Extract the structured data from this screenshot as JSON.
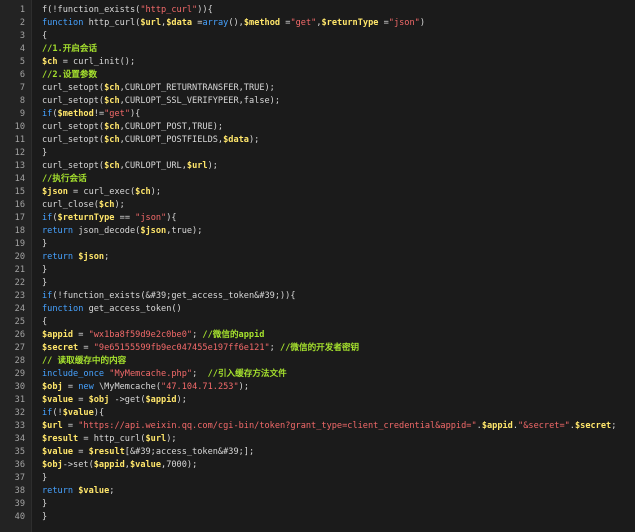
{
  "editor": {
    "line_numbers": [
      "1",
      "2",
      "3",
      "4",
      "5",
      "6",
      "7",
      "8",
      "9",
      "10",
      "11",
      "12",
      "13",
      "14",
      "15",
      "16",
      "17",
      "18",
      "19",
      "20",
      "21",
      "22",
      "23",
      "24",
      "25",
      "26",
      "27",
      "28",
      "29",
      "30",
      "31",
      "32",
      "33",
      "34",
      "35",
      "36",
      "37",
      "38",
      "39",
      "40"
    ],
    "lines": [
      [
        {
          "t": "f(!function_exists(",
          "c": "default"
        },
        {
          "t": "\"http_curl\"",
          "c": "str"
        },
        {
          "t": ")){",
          "c": "default"
        }
      ],
      [
        {
          "t": "function",
          "c": "kw"
        },
        {
          "t": " http_curl(",
          "c": "default"
        },
        {
          "t": "$url",
          "c": "var"
        },
        {
          "t": ",",
          "c": "default"
        },
        {
          "t": "$data",
          "c": "var"
        },
        {
          "t": " =",
          "c": "default"
        },
        {
          "t": "array",
          "c": "kw"
        },
        {
          "t": "(),",
          "c": "default"
        },
        {
          "t": "$method",
          "c": "var"
        },
        {
          "t": " =",
          "c": "default"
        },
        {
          "t": "\"get\"",
          "c": "str"
        },
        {
          "t": ",",
          "c": "default"
        },
        {
          "t": "$returnType",
          "c": "var"
        },
        {
          "t": " =",
          "c": "default"
        },
        {
          "t": "\"json\"",
          "c": "str"
        },
        {
          "t": ")",
          "c": "default"
        }
      ],
      [
        {
          "t": "{",
          "c": "default"
        }
      ],
      [
        {
          "t": "//1.开启会话",
          "c": "com"
        }
      ],
      [
        {
          "t": "$ch",
          "c": "var"
        },
        {
          "t": " = curl_init();",
          "c": "default"
        }
      ],
      [
        {
          "t": "//2.设置参数",
          "c": "com"
        }
      ],
      [
        {
          "t": "curl_setopt(",
          "c": "default"
        },
        {
          "t": "$ch",
          "c": "var"
        },
        {
          "t": ",CURLOPT_RETURNTRANSFER,TRUE);",
          "c": "default"
        }
      ],
      [
        {
          "t": "curl_setopt(",
          "c": "default"
        },
        {
          "t": "$ch",
          "c": "var"
        },
        {
          "t": ",CURLOPT_SSL_VERIFYPEER,false);",
          "c": "default"
        }
      ],
      [
        {
          "t": "if",
          "c": "kw"
        },
        {
          "t": "(",
          "c": "default"
        },
        {
          "t": "$method",
          "c": "var"
        },
        {
          "t": "!=",
          "c": "default"
        },
        {
          "t": "\"get\"",
          "c": "str"
        },
        {
          "t": "){",
          "c": "default"
        }
      ],
      [
        {
          "t": "curl_setopt(",
          "c": "default"
        },
        {
          "t": "$ch",
          "c": "var"
        },
        {
          "t": ",CURLOPT_POST,TRUE);",
          "c": "default"
        }
      ],
      [
        {
          "t": "curl_setopt(",
          "c": "default"
        },
        {
          "t": "$ch",
          "c": "var"
        },
        {
          "t": ",CURLOPT_POSTFIELDS,",
          "c": "default"
        },
        {
          "t": "$data",
          "c": "var"
        },
        {
          "t": ");",
          "c": "default"
        }
      ],
      [
        {
          "t": "}",
          "c": "default"
        }
      ],
      [
        {
          "t": "curl_setopt(",
          "c": "default"
        },
        {
          "t": "$ch",
          "c": "var"
        },
        {
          "t": ",CURLOPT_URL,",
          "c": "default"
        },
        {
          "t": "$url",
          "c": "var"
        },
        {
          "t": ");",
          "c": "default"
        }
      ],
      [
        {
          "t": "//执行会话",
          "c": "com"
        }
      ],
      [
        {
          "t": "$json",
          "c": "var"
        },
        {
          "t": " = curl_exec(",
          "c": "default"
        },
        {
          "t": "$ch",
          "c": "var"
        },
        {
          "t": ");",
          "c": "default"
        }
      ],
      [
        {
          "t": "curl_close(",
          "c": "default"
        },
        {
          "t": "$ch",
          "c": "var"
        },
        {
          "t": ");",
          "c": "default"
        }
      ],
      [
        {
          "t": "if",
          "c": "kw"
        },
        {
          "t": "(",
          "c": "default"
        },
        {
          "t": "$returnType",
          "c": "var"
        },
        {
          "t": " == ",
          "c": "default"
        },
        {
          "t": "\"json\"",
          "c": "str"
        },
        {
          "t": "){",
          "c": "default"
        }
      ],
      [
        {
          "t": "return",
          "c": "kw"
        },
        {
          "t": " json_decode(",
          "c": "default"
        },
        {
          "t": "$json",
          "c": "var"
        },
        {
          "t": ",true);",
          "c": "default"
        }
      ],
      [
        {
          "t": "}",
          "c": "default"
        }
      ],
      [
        {
          "t": "return",
          "c": "kw"
        },
        {
          "t": " ",
          "c": "default"
        },
        {
          "t": "$json",
          "c": "var"
        },
        {
          "t": ";",
          "c": "default"
        }
      ],
      [
        {
          "t": "}",
          "c": "default"
        }
      ],
      [
        {
          "t": "}",
          "c": "default"
        }
      ],
      [
        {
          "t": "if",
          "c": "kw"
        },
        {
          "t": "(!function_exists(&#39;get_access_token&#39;)){",
          "c": "default"
        }
      ],
      [
        {
          "t": "function",
          "c": "kw"
        },
        {
          "t": " get_access_token()",
          "c": "default"
        }
      ],
      [
        {
          "t": "{",
          "c": "default"
        }
      ],
      [
        {
          "t": "$appid",
          "c": "var"
        },
        {
          "t": " = ",
          "c": "default"
        },
        {
          "t": "\"wx1ba8f59d9e2c0be0\"",
          "c": "str"
        },
        {
          "t": "; ",
          "c": "default"
        },
        {
          "t": "//微信的appid",
          "c": "com"
        }
      ],
      [
        {
          "t": "$secret",
          "c": "var"
        },
        {
          "t": " = ",
          "c": "default"
        },
        {
          "t": "\"9e65155599fb9ec047455e197ff6e121\"",
          "c": "str"
        },
        {
          "t": "; ",
          "c": "default"
        },
        {
          "t": "//微信的开发者密钥",
          "c": "com"
        }
      ],
      [
        {
          "t": "// 读取缓存中的内容",
          "c": "com"
        }
      ],
      [
        {
          "t": "include_once",
          "c": "kw"
        },
        {
          "t": " ",
          "c": "default"
        },
        {
          "t": "\"MyMemcache.php\"",
          "c": "str"
        },
        {
          "t": ";  ",
          "c": "default"
        },
        {
          "t": "//引入缓存方法文件",
          "c": "com"
        }
      ],
      [
        {
          "t": "$obj",
          "c": "var"
        },
        {
          "t": " = ",
          "c": "default"
        },
        {
          "t": "new",
          "c": "kw"
        },
        {
          "t": " \\MyMemcache(",
          "c": "default"
        },
        {
          "t": "\"47.104.71.253\"",
          "c": "str"
        },
        {
          "t": ");",
          "c": "default"
        }
      ],
      [
        {
          "t": "$value",
          "c": "var"
        },
        {
          "t": " = ",
          "c": "default"
        },
        {
          "t": "$obj",
          "c": "var"
        },
        {
          "t": " ->get(",
          "c": "default"
        },
        {
          "t": "$appid",
          "c": "var"
        },
        {
          "t": ");",
          "c": "default"
        }
      ],
      [
        {
          "t": "if",
          "c": "kw"
        },
        {
          "t": "(!",
          "c": "default"
        },
        {
          "t": "$value",
          "c": "var"
        },
        {
          "t": "){",
          "c": "default"
        }
      ],
      [
        {
          "t": "$url",
          "c": "var"
        },
        {
          "t": " = ",
          "c": "default"
        },
        {
          "t": "\"https://api.weixin.qq.com/cgi-bin/token?grant_type=client_credential&appid=\"",
          "c": "str"
        },
        {
          "t": ".",
          "c": "default"
        },
        {
          "t": "$appid",
          "c": "var"
        },
        {
          "t": ".",
          "c": "default"
        },
        {
          "t": "\"&secret=\"",
          "c": "str"
        },
        {
          "t": ".",
          "c": "default"
        },
        {
          "t": "$secret",
          "c": "var"
        },
        {
          "t": ";",
          "c": "default"
        }
      ],
      [
        {
          "t": "$result",
          "c": "var"
        },
        {
          "t": " = http_curl(",
          "c": "default"
        },
        {
          "t": "$url",
          "c": "var"
        },
        {
          "t": ");",
          "c": "default"
        }
      ],
      [
        {
          "t": "$value",
          "c": "var"
        },
        {
          "t": " = ",
          "c": "default"
        },
        {
          "t": "$result",
          "c": "var"
        },
        {
          "t": "[&#39;access_token&#39;];",
          "c": "default"
        }
      ],
      [
        {
          "t": "$obj",
          "c": "var"
        },
        {
          "t": "->set(",
          "c": "default"
        },
        {
          "t": "$appid",
          "c": "var"
        },
        {
          "t": ",",
          "c": "default"
        },
        {
          "t": "$value",
          "c": "var"
        },
        {
          "t": ",7000);",
          "c": "default"
        }
      ],
      [
        {
          "t": "}",
          "c": "default"
        }
      ],
      [
        {
          "t": "return",
          "c": "kw"
        },
        {
          "t": " ",
          "c": "default"
        },
        {
          "t": "$value",
          "c": "var"
        },
        {
          "t": ";",
          "c": "default"
        }
      ],
      [
        {
          "t": "}",
          "c": "default"
        }
      ],
      [
        {
          "t": "}",
          "c": "default"
        }
      ]
    ]
  }
}
